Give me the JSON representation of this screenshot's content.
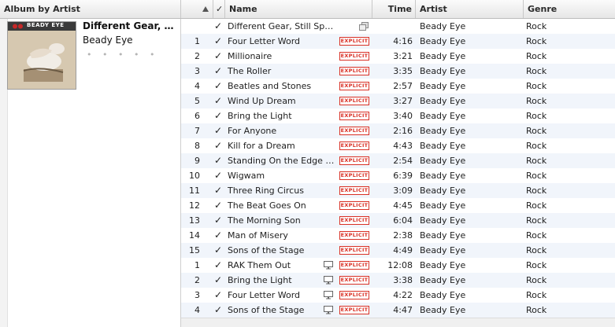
{
  "header": {
    "album_by_artist": "Album by Artist",
    "check": "✓",
    "name": "Name",
    "time": "Time",
    "artist": "Artist",
    "genre": "Genre"
  },
  "album": {
    "title": "Different Gear, Sti...",
    "artist": "Beady Eye",
    "rating": "• • • • •",
    "art_text": "BEADY EYE"
  },
  "colors": {
    "alt_row": "#f1f5fb",
    "explicit": "#d93025"
  },
  "icons": {
    "check": "checkmark-icon",
    "tv": "monitor-icon",
    "album": "album-stack-icon",
    "sort": "sort-triangle-icon"
  },
  "explicit_label": "EXPLICIT",
  "tracks": [
    {
      "num": "",
      "name": "Different Gear, Still Speeding (...",
      "time": "",
      "artist": "Beady Eye",
      "genre": "Rock",
      "explicit": false,
      "tv": false,
      "album_icon": true
    },
    {
      "num": "1",
      "name": "Four Letter Word",
      "time": "4:16",
      "artist": "Beady Eye",
      "genre": "Rock",
      "explicit": true,
      "tv": false
    },
    {
      "num": "2",
      "name": "Millionaire",
      "time": "3:21",
      "artist": "Beady Eye",
      "genre": "Rock",
      "explicit": true,
      "tv": false
    },
    {
      "num": "3",
      "name": "The Roller",
      "time": "3:35",
      "artist": "Beady Eye",
      "genre": "Rock",
      "explicit": true,
      "tv": false
    },
    {
      "num": "4",
      "name": "Beatles and Stones",
      "time": "2:57",
      "artist": "Beady Eye",
      "genre": "Rock",
      "explicit": true,
      "tv": false
    },
    {
      "num": "5",
      "name": "Wind Up Dream",
      "time": "3:27",
      "artist": "Beady Eye",
      "genre": "Rock",
      "explicit": true,
      "tv": false
    },
    {
      "num": "6",
      "name": "Bring the Light",
      "time": "3:40",
      "artist": "Beady Eye",
      "genre": "Rock",
      "explicit": true,
      "tv": false
    },
    {
      "num": "7",
      "name": "For Anyone",
      "time": "2:16",
      "artist": "Beady Eye",
      "genre": "Rock",
      "explicit": true,
      "tv": false
    },
    {
      "num": "8",
      "name": "Kill for a Dream",
      "time": "4:43",
      "artist": "Beady Eye",
      "genre": "Rock",
      "explicit": true,
      "tv": false
    },
    {
      "num": "9",
      "name": "Standing On the Edge of t...",
      "time": "2:54",
      "artist": "Beady Eye",
      "genre": "Rock",
      "explicit": true,
      "tv": false
    },
    {
      "num": "10",
      "name": "Wigwam",
      "time": "6:39",
      "artist": "Beady Eye",
      "genre": "Rock",
      "explicit": true,
      "tv": false
    },
    {
      "num": "11",
      "name": "Three Ring Circus",
      "time": "3:09",
      "artist": "Beady Eye",
      "genre": "Rock",
      "explicit": true,
      "tv": false
    },
    {
      "num": "12",
      "name": "The Beat Goes On",
      "time": "4:45",
      "artist": "Beady Eye",
      "genre": "Rock",
      "explicit": true,
      "tv": false
    },
    {
      "num": "13",
      "name": "The Morning Son",
      "time": "6:04",
      "artist": "Beady Eye",
      "genre": "Rock",
      "explicit": true,
      "tv": false
    },
    {
      "num": "14",
      "name": "Man of Misery",
      "time": "2:38",
      "artist": "Beady Eye",
      "genre": "Rock",
      "explicit": true,
      "tv": false
    },
    {
      "num": "15",
      "name": "Sons of the Stage",
      "time": "4:49",
      "artist": "Beady Eye",
      "genre": "Rock",
      "explicit": true,
      "tv": false
    },
    {
      "num": "1",
      "name": "RAK Them Out",
      "time": "12:08",
      "artist": "Beady Eye",
      "genre": "Rock",
      "explicit": true,
      "tv": true
    },
    {
      "num": "2",
      "name": "Bring the Light",
      "time": "3:38",
      "artist": "Beady Eye",
      "genre": "Rock",
      "explicit": true,
      "tv": true
    },
    {
      "num": "3",
      "name": "Four Letter Word",
      "time": "4:22",
      "artist": "Beady Eye",
      "genre": "Rock",
      "explicit": true,
      "tv": true
    },
    {
      "num": "4",
      "name": "Sons of the Stage",
      "time": "4:47",
      "artist": "Beady Eye",
      "genre": "Rock",
      "explicit": true,
      "tv": true
    }
  ]
}
